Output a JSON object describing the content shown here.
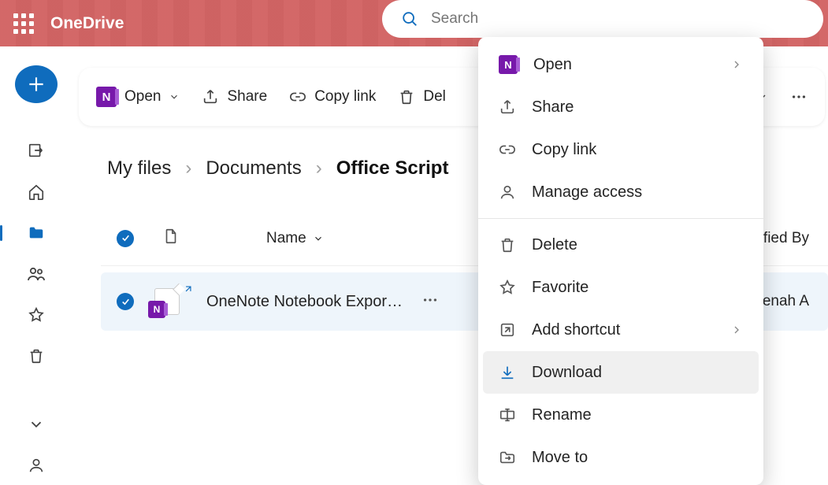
{
  "product_name": "OneDrive",
  "search": {
    "placeholder": "Search"
  },
  "toolbar": {
    "open": "Open",
    "share": "Share",
    "copy_link": "Copy link",
    "delete": "Del"
  },
  "breadcrumb": {
    "crumbs": [
      "My files",
      "Documents",
      "Office Script"
    ]
  },
  "columns": {
    "name": "Name",
    "modified_by": "lified By"
  },
  "file": {
    "name": "OneNote Notebook Expor…",
    "modified_by": "anjenah A",
    "selected": true
  },
  "context_menu": {
    "open": "Open",
    "share": "Share",
    "copy_link": "Copy link",
    "manage_access": "Manage access",
    "delete": "Delete",
    "favorite": "Favorite",
    "add_shortcut": "Add shortcut",
    "download": "Download",
    "rename": "Rename",
    "move_to": "Move to",
    "highlighted": "download"
  },
  "colors": {
    "accent": "#0f6cbd"
  }
}
